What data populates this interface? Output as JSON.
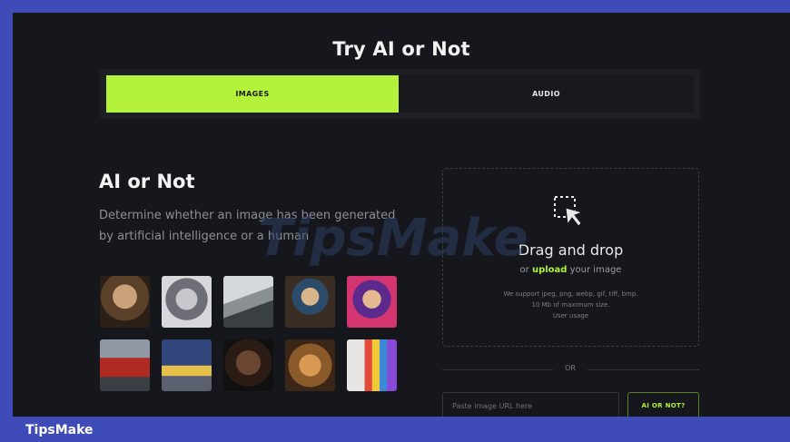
{
  "header": {
    "title": "Try AI or Not"
  },
  "tabs": [
    {
      "label": "IMAGES",
      "active": true
    },
    {
      "label": "AUDIO",
      "active": false
    }
  ],
  "intro": {
    "heading": "AI or Not",
    "description": "Determine whether an image has been generated by artificial intelligence or a human"
  },
  "examples": {
    "thumbnails": [
      "old-man-portrait",
      "silver-alien-woman",
      "polar-bear-scene",
      "girl-with-pearl-earring",
      "neon-anime-girl",
      "red-sports-car",
      "tiger-on-road",
      "dark-portrait-face",
      "cat-figurine",
      "pope-in-rainbow-coat"
    ]
  },
  "dropzone": {
    "icon": "select-cursor-icon",
    "title": "Drag and drop",
    "sub_prefix": "or",
    "sub_link": "upload",
    "sub_suffix": "your image",
    "note_line1": "We support jpeg, png, webp, gif, tiff, bmp.",
    "note_line2": "10 Mb of maximum size.",
    "note_line3": "User usage"
  },
  "divider": {
    "label": "OR"
  },
  "url_form": {
    "placeholder": "Paste image URL here",
    "button_label": "AI OR NOT?"
  },
  "watermark": {
    "text": "TipsMake"
  },
  "footer": {
    "label": "TipsMake"
  },
  "colors": {
    "accent": "#b5f23b",
    "background": "#15171c",
    "frame": "#3f4bb7"
  }
}
